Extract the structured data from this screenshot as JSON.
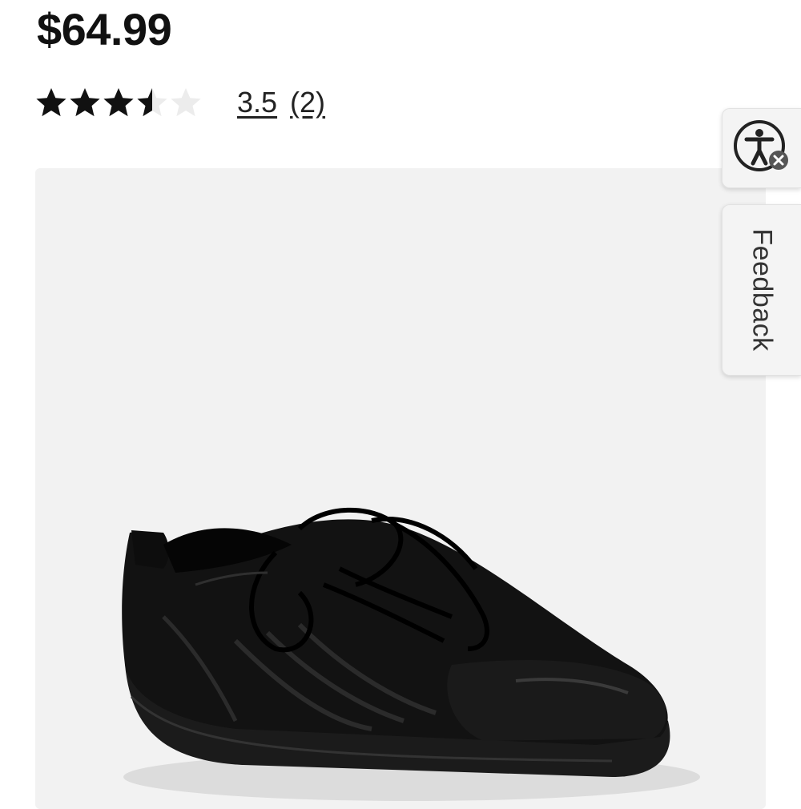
{
  "product": {
    "price": "$64.99",
    "rating": {
      "value_label": "3.5",
      "count_label": "(2)",
      "stars_filled": 3.5,
      "stars_total": 5
    },
    "image": {
      "alt": "Black leather lace-up sneaker"
    }
  },
  "side_tabs": {
    "accessibility_icon": "accessibility-icon",
    "feedback_label": "Feedback"
  },
  "colors": {
    "star_filled": "#111111",
    "star_empty": "#ececec",
    "image_bg": "#f2f2f2"
  }
}
